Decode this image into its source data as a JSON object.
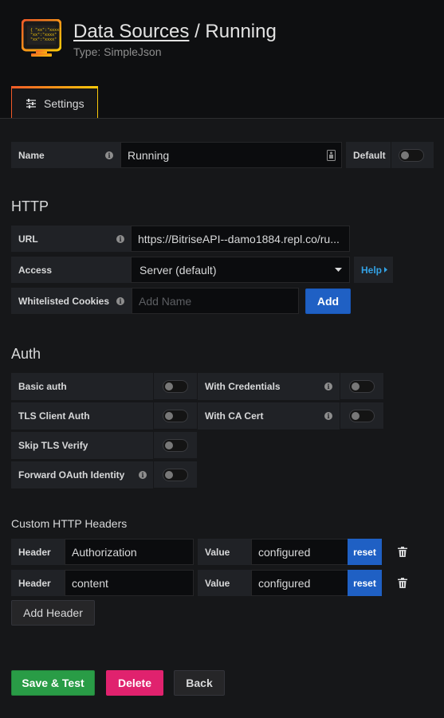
{
  "header": {
    "title_link": "Data Sources",
    "title_sep": " / ",
    "title_name": "Running",
    "subtitle": "Type: SimpleJson"
  },
  "tabs": [
    {
      "label": "Settings",
      "icon": "sliders-icon"
    }
  ],
  "name_row": {
    "label": "Name",
    "value": "Running",
    "default_label": "Default",
    "default_on": false
  },
  "http": {
    "title": "HTTP",
    "url_label": "URL",
    "url_value": "https://BitriseAPI--damo1884.repl.co/ru...",
    "access_label": "Access",
    "access_value": "Server (default)",
    "help_label": "Help",
    "cookies_label": "Whitelisted Cookies",
    "cookies_placeholder": "Add Name",
    "add_label": "Add"
  },
  "auth": {
    "title": "Auth",
    "basic_auth": {
      "label": "Basic auth",
      "on": false
    },
    "with_credentials": {
      "label": "With Credentials",
      "on": false
    },
    "tls_client_auth": {
      "label": "TLS Client Auth",
      "on": false
    },
    "with_ca_cert": {
      "label": "With CA Cert",
      "on": false
    },
    "skip_tls_verify": {
      "label": "Skip TLS Verify",
      "on": false
    },
    "forward_oauth": {
      "label": "Forward OAuth Identity",
      "on": false
    }
  },
  "custom_headers": {
    "title": "Custom HTTP Headers",
    "rows": [
      {
        "header_label": "Header",
        "header_value": "Authorization",
        "value_label": "Value",
        "value": "configured",
        "reset_label": "reset"
      },
      {
        "header_label": "Header",
        "header_value": "content",
        "value_label": "Value",
        "value": "configured",
        "reset_label": "reset"
      }
    ],
    "add_label": "Add Header"
  },
  "actions": {
    "save_label": "Save & Test",
    "delete_label": "Delete",
    "back_label": "Back"
  },
  "colors": {
    "accent_orange": "#f05a28",
    "primary_blue": "#1f60c4",
    "success_green": "#299c46",
    "danger_red": "#e0226e"
  }
}
